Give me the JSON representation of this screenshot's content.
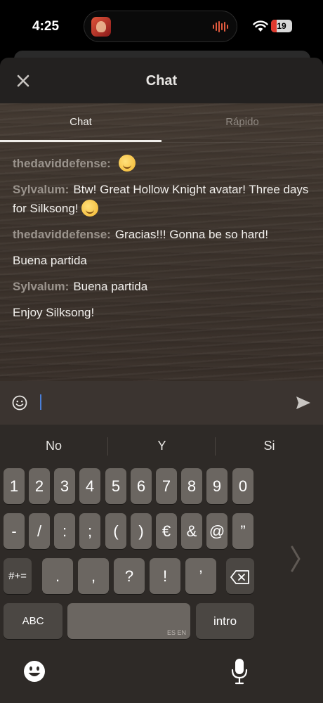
{
  "status": {
    "time": "4:25",
    "battery": "19"
  },
  "header": {
    "title": "Chat"
  },
  "tabs": [
    {
      "label": "Chat",
      "active": true
    },
    {
      "label": "Rápido",
      "active": false
    }
  ],
  "messages": [
    {
      "user": "thedaviddefense:",
      "text": "",
      "emoji": "yawning-face"
    },
    {
      "user": "Sylvalum:",
      "text": "Btw! Great Hollow Knight avatar! Three days for Silksong!",
      "emoji": "smiling-face"
    },
    {
      "user": "thedaviddefense:",
      "text": "Gracias!!! Gonna be so hard!",
      "emoji": ""
    },
    {
      "user": "",
      "text": "Buena partida",
      "emoji": ""
    },
    {
      "user": "Sylvalum:",
      "text": "Buena partida",
      "emoji": ""
    },
    {
      "user": "",
      "text": "Enjoy Silksong!",
      "emoji": ""
    }
  ],
  "input": {
    "value": ""
  },
  "keyboard": {
    "suggestions": [
      "No",
      "Y",
      "Si"
    ],
    "row1": [
      "1",
      "2",
      "3",
      "4",
      "5",
      "6",
      "7",
      "8",
      "9",
      "0"
    ],
    "row2": [
      "-",
      "/",
      ":",
      ";",
      "(",
      ")",
      "€",
      "&",
      "@",
      "”"
    ],
    "row3": [
      ".",
      ",",
      "?",
      "!",
      "’"
    ],
    "symbols_label": "#+=",
    "abc_label": "ABC",
    "space_languages": "ES EN",
    "return_label": "intro"
  },
  "colors": {
    "accent_cursor": "#4a7fd8",
    "username": "#9a938c",
    "battery_low": "#e0392d"
  }
}
